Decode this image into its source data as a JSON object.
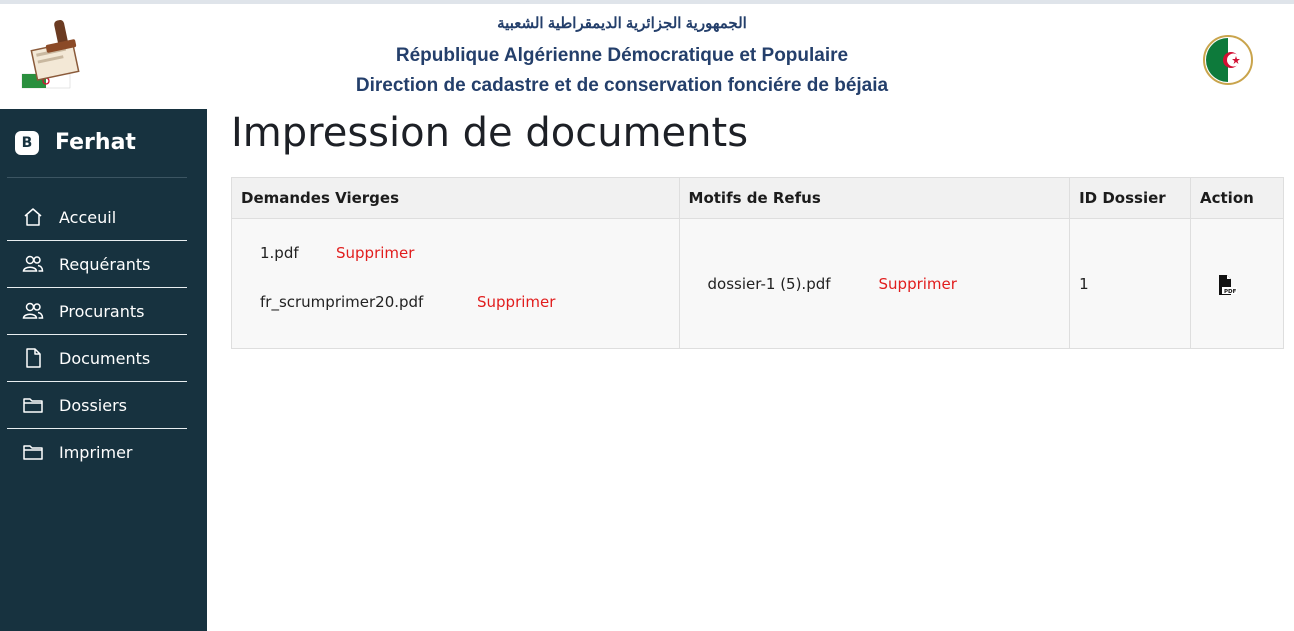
{
  "header": {
    "arabic": "الجمهورية الجزائرية الديمقراطية الشعبية",
    "line1": "République Algérienne Démocratique et Populaire",
    "line2": "Direction de cadastre et de conservation fonciére de béjaia"
  },
  "sidebar": {
    "brand_badge": "B",
    "brand_name": "Ferhat",
    "items": [
      {
        "label": "Acceuil",
        "icon": "home-icon"
      },
      {
        "label": "Requérants",
        "icon": "users-icon"
      },
      {
        "label": "Procurants",
        "icon": "users-icon"
      },
      {
        "label": "Documents",
        "icon": "document-icon"
      },
      {
        "label": "Dossiers",
        "icon": "folder-icon"
      },
      {
        "label": "Imprimer",
        "icon": "folder-icon"
      }
    ]
  },
  "main": {
    "title": "Impression de documents"
  },
  "table": {
    "headers": [
      "Demandes Vierges",
      "Motifs de Refus",
      "ID Dossier",
      "Action"
    ],
    "row": {
      "demandes": [
        {
          "file": "1.pdf",
          "action": "Supprimer"
        },
        {
          "file": "fr_scrumprimer20.pdf",
          "action": "Supprimer"
        }
      ],
      "motifs": [
        {
          "file": "dossier-1 (5).pdf",
          "action": "Supprimer"
        }
      ],
      "id": "1",
      "action_icon": "pdf-file-icon"
    }
  },
  "colors": {
    "sidebar_bg": "#17323f",
    "header_text": "#243f6b",
    "delete_red": "#e11d1d"
  }
}
